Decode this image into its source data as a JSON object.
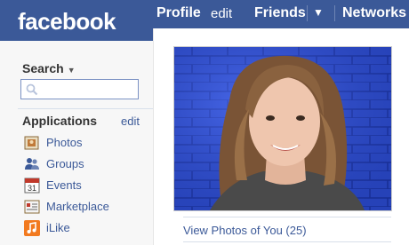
{
  "brand": {
    "logo_text": "facebook",
    "color": "#3b5998"
  },
  "topnav": {
    "items": [
      {
        "label": "Profile"
      },
      {
        "label": "edit"
      },
      {
        "label": "Friends"
      },
      {
        "label": "▼"
      },
      {
        "label": "Networks"
      }
    ]
  },
  "sidebar": {
    "search_label": "Search",
    "search_caret": "▼",
    "search_placeholder": "",
    "applications_label": "Applications",
    "applications_edit": "edit",
    "apps": [
      {
        "label": "Photos",
        "icon": "photos-icon"
      },
      {
        "label": "Groups",
        "icon": "groups-icon"
      },
      {
        "label": "Events",
        "icon": "events-icon",
        "icon_text": "31"
      },
      {
        "label": "Marketplace",
        "icon": "marketplace-icon"
      },
      {
        "label": "iLike",
        "icon": "ilike-icon"
      }
    ]
  },
  "profile": {
    "view_photos_link": "View Photos of You (25)"
  }
}
